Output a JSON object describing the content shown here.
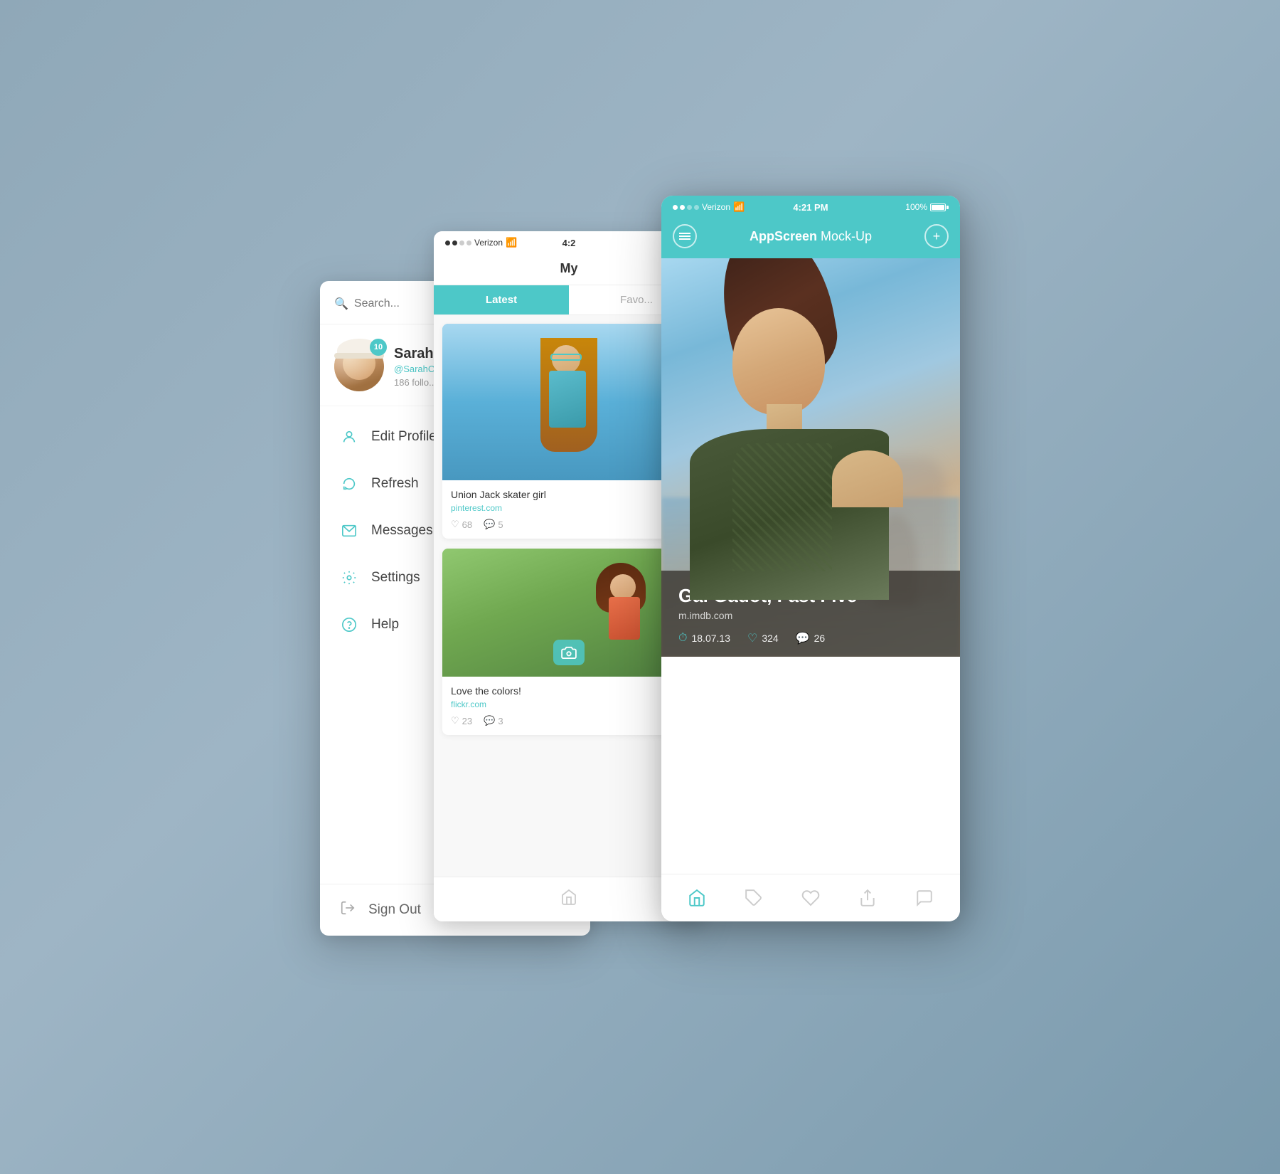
{
  "scene": {
    "background": "#9ab2c4"
  },
  "sidebar": {
    "search_placeholder": "Search...",
    "user": {
      "name": "Sarah",
      "handle": "@SarahC",
      "followers": "186 follo...",
      "badge": "10"
    },
    "menu_items": [
      {
        "id": "edit-profile",
        "label": "Edit Profile",
        "icon": "person"
      },
      {
        "id": "refresh",
        "label": "Refresh",
        "icon": "refresh"
      },
      {
        "id": "messages",
        "label": "Messages",
        "icon": "mail"
      },
      {
        "id": "settings",
        "label": "Settings",
        "icon": "gear"
      },
      {
        "id": "help",
        "label": "Help",
        "icon": "question"
      }
    ],
    "sign_out_label": "Sign Out"
  },
  "feed": {
    "status": {
      "carrier": "Verizon",
      "wifi": "WiFi",
      "time": "4:2",
      "battery": ""
    },
    "title": "My",
    "tabs": [
      {
        "label": "Latest",
        "active": true
      },
      {
        "label": "Favo...",
        "active": false
      }
    ],
    "cards": [
      {
        "title": "Union Jack skater girl",
        "source": "pinterest.com",
        "likes": "68",
        "comments": "5"
      },
      {
        "title": "Love the colors!",
        "source": "flickr.com",
        "likes": "23",
        "comments": "3"
      }
    ]
  },
  "detail": {
    "status": {
      "carrier": "Verizon",
      "wifi": "WiFi",
      "time": "4:21 PM",
      "battery": "100%"
    },
    "header_title": "AppScreen",
    "header_subtitle": " Mock-Up",
    "item": {
      "title": "Gal Gadot, Fast Five",
      "source": "m.imdb.com",
      "date": "18.07.13",
      "likes": "324",
      "comments": "26"
    },
    "bottom_nav": [
      {
        "id": "home",
        "label": "",
        "active": true
      },
      {
        "id": "tag",
        "label": "",
        "active": false
      },
      {
        "id": "heart",
        "label": "",
        "active": false
      },
      {
        "id": "share",
        "label": "",
        "active": false
      },
      {
        "id": "comment",
        "label": "",
        "active": false
      }
    ]
  }
}
